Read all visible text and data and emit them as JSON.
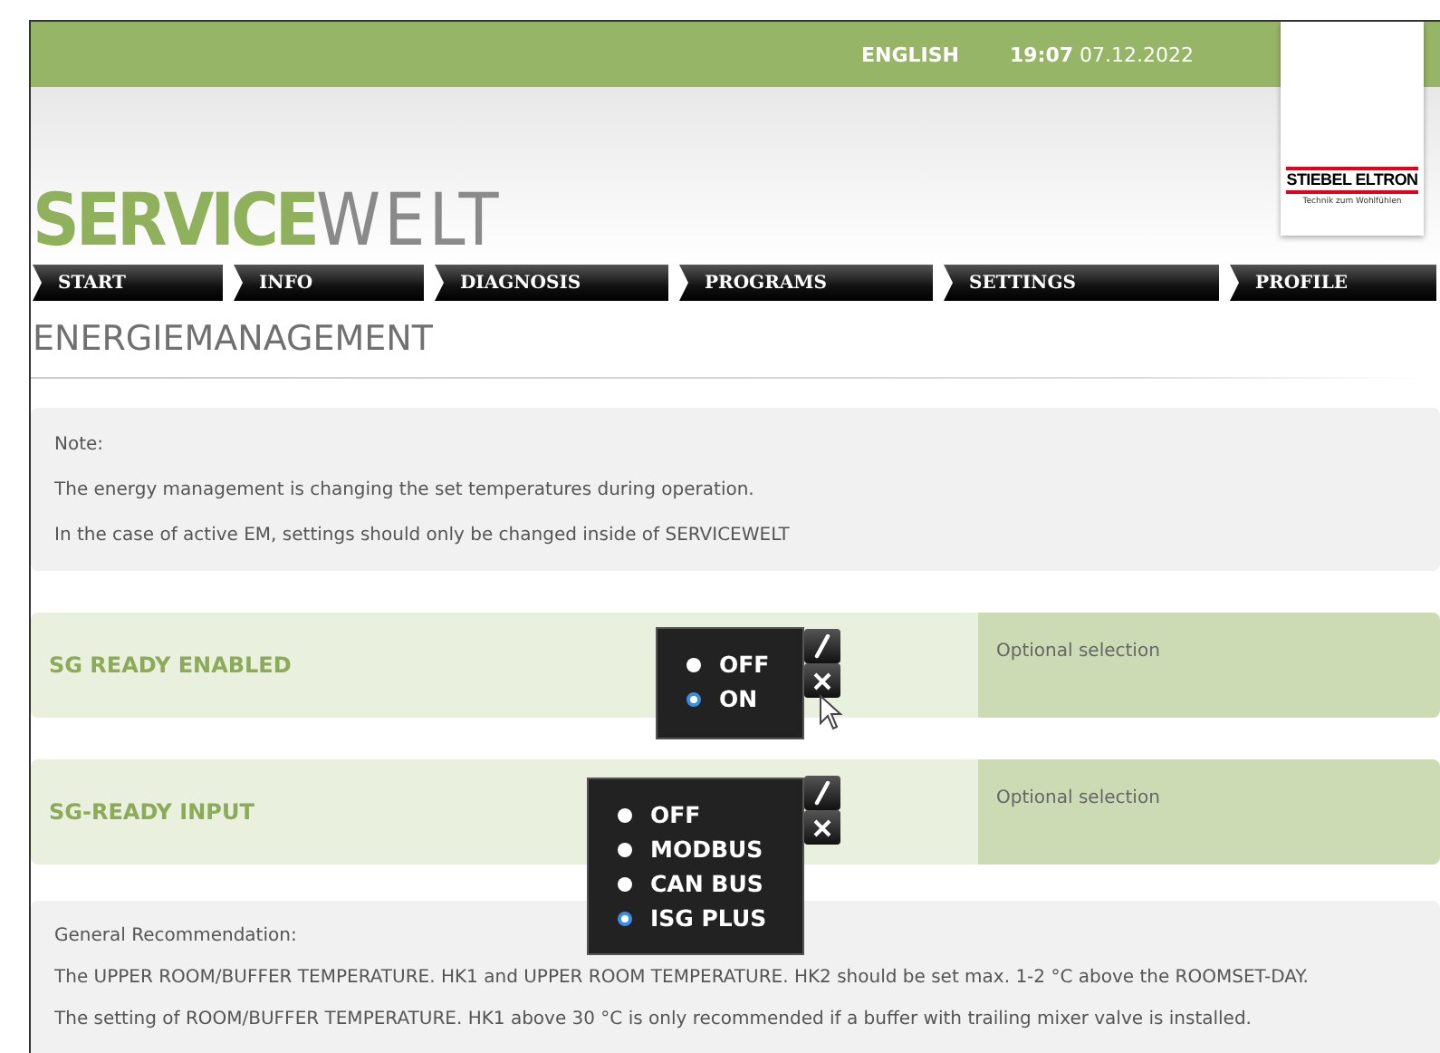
{
  "header": {
    "language": "ENGLISH",
    "time": "19:07",
    "date": "07.12.2022"
  },
  "brand": {
    "logo_strong": "SERVICE",
    "logo_light": "WELT",
    "company": "STIEBEL ELTRON",
    "slogan": "Technik zum Wohlfühlen"
  },
  "nav": [
    {
      "label": "START",
      "selected": false
    },
    {
      "label": "INFO",
      "selected": false
    },
    {
      "label": "DIAGNOSIS",
      "selected": false
    },
    {
      "label": "PROGRAMS",
      "selected": false
    },
    {
      "label": "SETTINGS",
      "selected": false
    },
    {
      "label": "PROFILE",
      "selected": false
    }
  ],
  "page_title": "ENERGIEMANAGEMENT",
  "note": [
    "Note:",
    "The energy management is changing the set temperatures during operation.",
    "In the case of active EM, settings should only be changed inside of SERVICEWELT"
  ],
  "settings": [
    {
      "label": "SG READY ENABLED",
      "hint": "Optional selection",
      "options": [
        {
          "label": "OFF",
          "selected": false
        },
        {
          "label": "ON",
          "selected": true
        }
      ]
    },
    {
      "label": "SG-READY INPUT",
      "hint": "Optional selection",
      "options": [
        {
          "label": "OFF",
          "selected": false
        },
        {
          "label": "MODBUS",
          "selected": false
        },
        {
          "label": "CAN BUS",
          "selected": false
        },
        {
          "label": "ISG PLUS",
          "selected": true
        }
      ]
    }
  ],
  "recommendation": [
    "General Recommendation:",
    "The UPPER ROOM/BUFFER TEMPERATURE. HK1 and UPPER ROOM TEMPERATURE. HK2 should be set max. 1-2 °C above the ROOMSET-DAY.",
    "The setting of ROOM/BUFFER TEMPERATURE. HK1 above 30 °C is only recommended if a buffer with trailing mixer valve is installed."
  ]
}
